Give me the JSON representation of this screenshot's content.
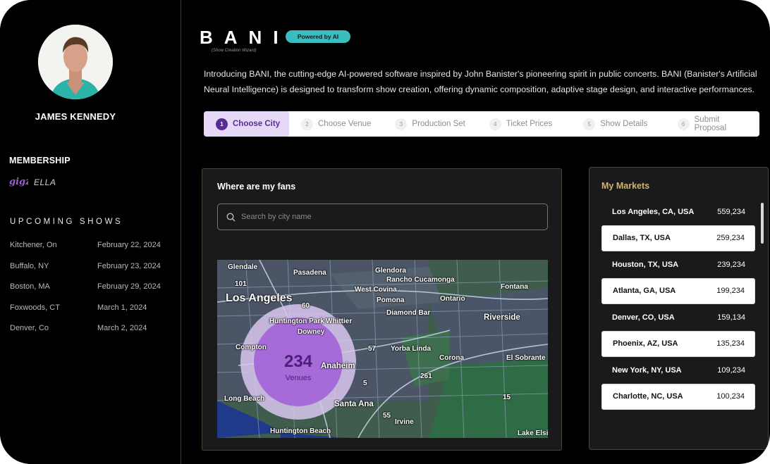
{
  "user": {
    "name": "JAMES KENNEDY"
  },
  "membership": {
    "title": "MEMBERSHIP",
    "logo_text": "gigz",
    "tier": "ELLA"
  },
  "upcoming": {
    "title": "UPCOMING SHOWS",
    "shows": [
      {
        "city": "Kitchener, On",
        "date": "February 22, 2024"
      },
      {
        "city": "Buffalo, NY",
        "date": "February 23, 2024"
      },
      {
        "city": "Boston, MA",
        "date": "February 29, 2024"
      },
      {
        "city": "Foxwoods, CT",
        "date": "March 1, 2024"
      },
      {
        "city": "Denver, Co",
        "date": "March 2, 2024"
      }
    ]
  },
  "brand": {
    "name": "BANI",
    "subtitle": "(Show Creation Wizard)",
    "badge": "Powered by AI"
  },
  "intro": "Introducing BANI, the cutting-edge AI-powered software inspired by John Banister's pioneering spirit in public concerts. BANI (Banister's Artificial Neural Intelligence) is designed to transform show creation, offering dynamic composition, adaptive stage design, and interactive performances.",
  "steps": [
    {
      "num": "1",
      "label": "Choose City",
      "active": true
    },
    {
      "num": "2",
      "label": "Choose Venue"
    },
    {
      "num": "3",
      "label": "Production Set"
    },
    {
      "num": "4",
      "label": "Ticket Prices"
    },
    {
      "num": "5",
      "label": "Show Details"
    },
    {
      "num": "6",
      "label": "Submit Proposal"
    }
  ],
  "fans": {
    "title": "Where are my fans",
    "search_placeholder": "Search by city name",
    "venue_count": "234",
    "venue_label": "Venues",
    "map_labels": {
      "glendale": "Glendale",
      "pasadena": "Pasadena",
      "glendora": "Glendora",
      "rancho": "Rancho Cucamonga",
      "west_covina": "West Covina",
      "fontana": "Fontana",
      "los_angeles": "Los Angeles",
      "pomona": "Pomona",
      "ontario": "Ontario",
      "diamond_bar": "Diamond Bar",
      "huntington_park": "Huntington Park",
      "whittier": "Whittier",
      "downey": "Downey",
      "riverside": "Riverside",
      "compton": "Compton",
      "yorba_linda": "Yorba Linda",
      "anaheim": "Anaheim",
      "corona": "Corona",
      "el_sobrante": "El Sobrante",
      "long_beach": "Long Beach",
      "santa_ana": "Santa Ana",
      "irvine": "Irvine",
      "huntington_beach": "Huntington Beach",
      "lake_elsinore": "Lake Elsino",
      "hw_101": "101",
      "hw_60": "60",
      "hw_57": "57",
      "hw_261": "261",
      "hw_15": "15",
      "hw_55": "55",
      "hw_5": "5"
    }
  },
  "markets": {
    "title": "My Markets",
    "items": [
      {
        "city": "Los Angeles, CA, USA",
        "value": "559,234",
        "highlight": false
      },
      {
        "city": "Dallas, TX, USA",
        "value": "259,234",
        "highlight": true
      },
      {
        "city": "Houston, TX, USA",
        "value": "239,234",
        "highlight": false
      },
      {
        "city": "Atlanta, GA, USA",
        "value": "199,234",
        "highlight": true
      },
      {
        "city": "Denver, CO, USA",
        "value": "159,134",
        "highlight": false
      },
      {
        "city": "Phoenix, AZ, USA",
        "value": "135,234",
        "highlight": true
      },
      {
        "city": "New York, NY, USA",
        "value": "109,234",
        "highlight": false
      },
      {
        "city": "Charlotte, NC, USA",
        "value": "100,234",
        "highlight": true
      }
    ]
  },
  "colors": {
    "accent": "#5b2b9a",
    "badge": "#3bbdc0",
    "markets_title": "#d2b46a",
    "map_land": "#3f5c4c",
    "map_water": "#1f3a8a"
  }
}
